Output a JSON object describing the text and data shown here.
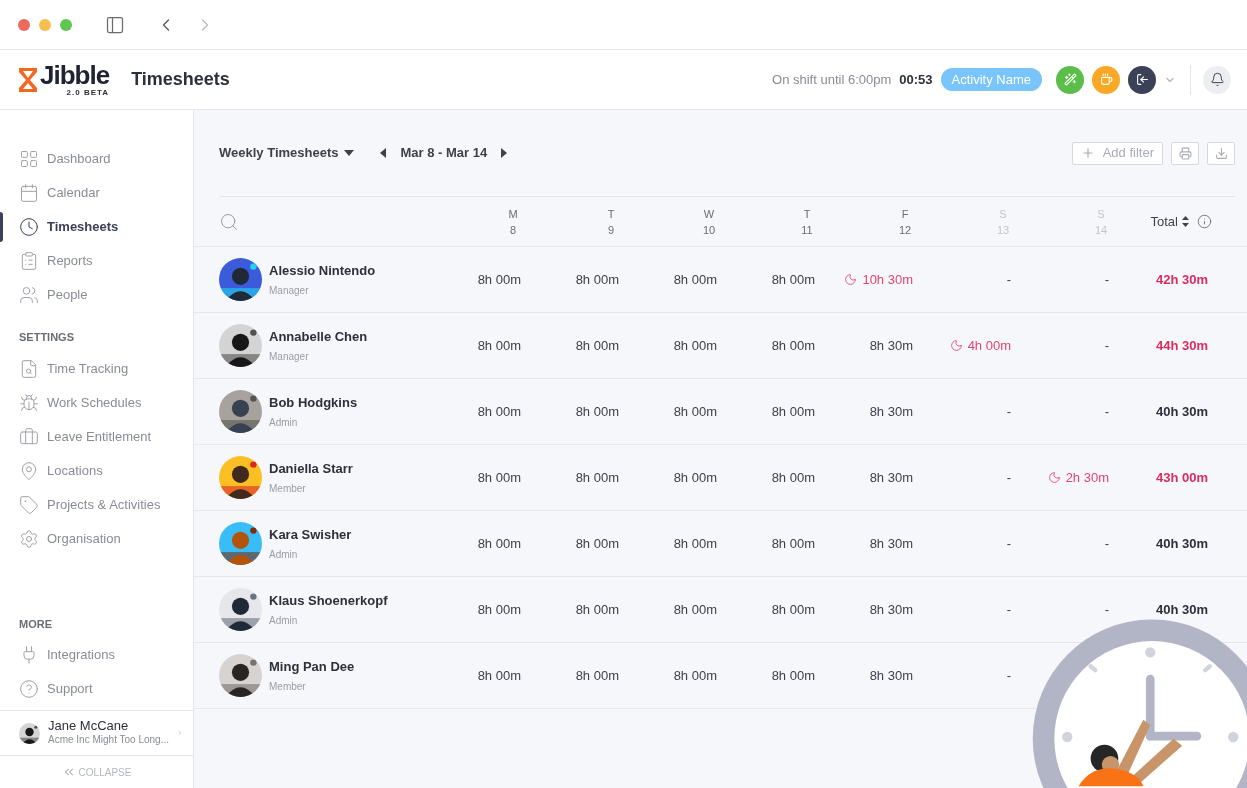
{
  "app": {
    "logo": "Jibble",
    "logo_badge": "2.0 BETA",
    "page_title": "Timesheets"
  },
  "shift": {
    "label": "On shift until 6:00pm",
    "timer": "00:53",
    "activity": "Activity Name"
  },
  "sidebar": {
    "sections": [
      {
        "items": [
          {
            "label": "Dashboard",
            "selected": false
          },
          {
            "label": "Calendar",
            "selected": false
          },
          {
            "label": "Timesheets",
            "selected": true
          },
          {
            "label": "Reports",
            "selected": false
          },
          {
            "label": "People",
            "selected": false
          }
        ]
      },
      {
        "title": "SETTINGS",
        "items": [
          {
            "label": "Time Tracking",
            "selected": false
          },
          {
            "label": "Work Schedules",
            "selected": false
          },
          {
            "label": "Leave Entitlement",
            "selected": false
          },
          {
            "label": "Locations",
            "selected": false
          },
          {
            "label": "Projects & Activities",
            "selected": false
          },
          {
            "label": "Organisation",
            "selected": false
          }
        ]
      },
      {
        "title": "MORE",
        "items": [
          {
            "label": "Integrations",
            "selected": false
          },
          {
            "label": "Support",
            "selected": false
          }
        ]
      }
    ],
    "user": {
      "name": "Jane McCane",
      "org": "Acme Inc Might Too Long..."
    },
    "collapse": "COLLAPSE"
  },
  "toolbar": {
    "view": "Weekly Timesheets",
    "range": "Mar 8 - Mar 14",
    "add_filter": "Add filter"
  },
  "table": {
    "columns": [
      {
        "day": "M",
        "date": "8",
        "muted": false
      },
      {
        "day": "T",
        "date": "9",
        "muted": false
      },
      {
        "day": "W",
        "date": "10",
        "muted": false
      },
      {
        "day": "T",
        "date": "11",
        "muted": false
      },
      {
        "day": "F",
        "date": "12",
        "muted": false
      },
      {
        "day": "S",
        "date": "13",
        "muted": true
      },
      {
        "day": "S",
        "date": "14",
        "muted": true
      }
    ],
    "total_label": "Total",
    "rows": [
      {
        "name": "Alessio Nintendo",
        "role": "Manager",
        "cells": [
          {
            "text": "8h 00m",
            "kind": "normal"
          },
          {
            "text": "8h 00m",
            "kind": "normal"
          },
          {
            "text": "8h 00m",
            "kind": "normal"
          },
          {
            "text": "8h 00m",
            "kind": "normal"
          },
          {
            "text": "10h 30m",
            "kind": "overtime"
          },
          {
            "text": "-",
            "kind": "normal"
          },
          {
            "text": "-",
            "kind": "normal"
          }
        ],
        "total": "42h 30m",
        "over": true
      },
      {
        "name": "Annabelle Chen",
        "role": "Manager",
        "cells": [
          {
            "text": "8h 00m",
            "kind": "normal"
          },
          {
            "text": "8h 00m",
            "kind": "normal"
          },
          {
            "text": "8h 00m",
            "kind": "normal"
          },
          {
            "text": "8h 00m",
            "kind": "normal"
          },
          {
            "text": "8h 30m",
            "kind": "normal"
          },
          {
            "text": "4h 00m",
            "kind": "overtime"
          },
          {
            "text": "-",
            "kind": "normal"
          }
        ],
        "total": "44h 30m",
        "over": true
      },
      {
        "name": "Bob Hodgkins",
        "role": "Admin",
        "cells": [
          {
            "text": "8h 00m",
            "kind": "normal"
          },
          {
            "text": "8h 00m",
            "kind": "normal"
          },
          {
            "text": "8h 00m",
            "kind": "normal"
          },
          {
            "text": "8h 00m",
            "kind": "normal"
          },
          {
            "text": "8h 30m",
            "kind": "normal"
          },
          {
            "text": "-",
            "kind": "normal"
          },
          {
            "text": "-",
            "kind": "normal"
          }
        ],
        "total": "40h 30m",
        "over": false
      },
      {
        "name": "Daniella Starr",
        "role": "Member",
        "cells": [
          {
            "text": "8h 00m",
            "kind": "normal"
          },
          {
            "text": "8h 00m",
            "kind": "normal"
          },
          {
            "text": "8h 00m",
            "kind": "normal"
          },
          {
            "text": "8h 00m",
            "kind": "normal"
          },
          {
            "text": "8h 30m",
            "kind": "normal"
          },
          {
            "text": "-",
            "kind": "normal"
          },
          {
            "text": "2h 30m",
            "kind": "overtime"
          }
        ],
        "total": "43h 00m",
        "over": true
      },
      {
        "name": "Kara Swisher",
        "role": "Admin",
        "cells": [
          {
            "text": "8h 00m",
            "kind": "normal"
          },
          {
            "text": "8h 00m",
            "kind": "normal"
          },
          {
            "text": "8h 00m",
            "kind": "normal"
          },
          {
            "text": "8h 00m",
            "kind": "normal"
          },
          {
            "text": "8h 30m",
            "kind": "normal"
          },
          {
            "text": "-",
            "kind": "normal"
          },
          {
            "text": "-",
            "kind": "normal"
          }
        ],
        "total": "40h 30m",
        "over": false
      },
      {
        "name": "Klaus Shoenerkopf",
        "role": "Admin",
        "cells": [
          {
            "text": "8h 00m",
            "kind": "normal"
          },
          {
            "text": "8h 00m",
            "kind": "normal"
          },
          {
            "text": "8h 00m",
            "kind": "normal"
          },
          {
            "text": "8h 00m",
            "kind": "normal"
          },
          {
            "text": "8h 30m",
            "kind": "normal"
          },
          {
            "text": "-",
            "kind": "normal"
          },
          {
            "text": "-",
            "kind": "normal"
          }
        ],
        "total": "40h 30m",
        "over": false
      },
      {
        "name": "Ming Pan Dee",
        "role": "Member",
        "cells": [
          {
            "text": "8h 00m",
            "kind": "normal"
          },
          {
            "text": "8h 00m",
            "kind": "normal"
          },
          {
            "text": "8h 00m",
            "kind": "normal"
          },
          {
            "text": "8h 00m",
            "kind": "normal"
          },
          {
            "text": "8h 30m",
            "kind": "normal"
          },
          {
            "text": "-",
            "kind": "normal"
          }
        ]
      }
    ]
  }
}
